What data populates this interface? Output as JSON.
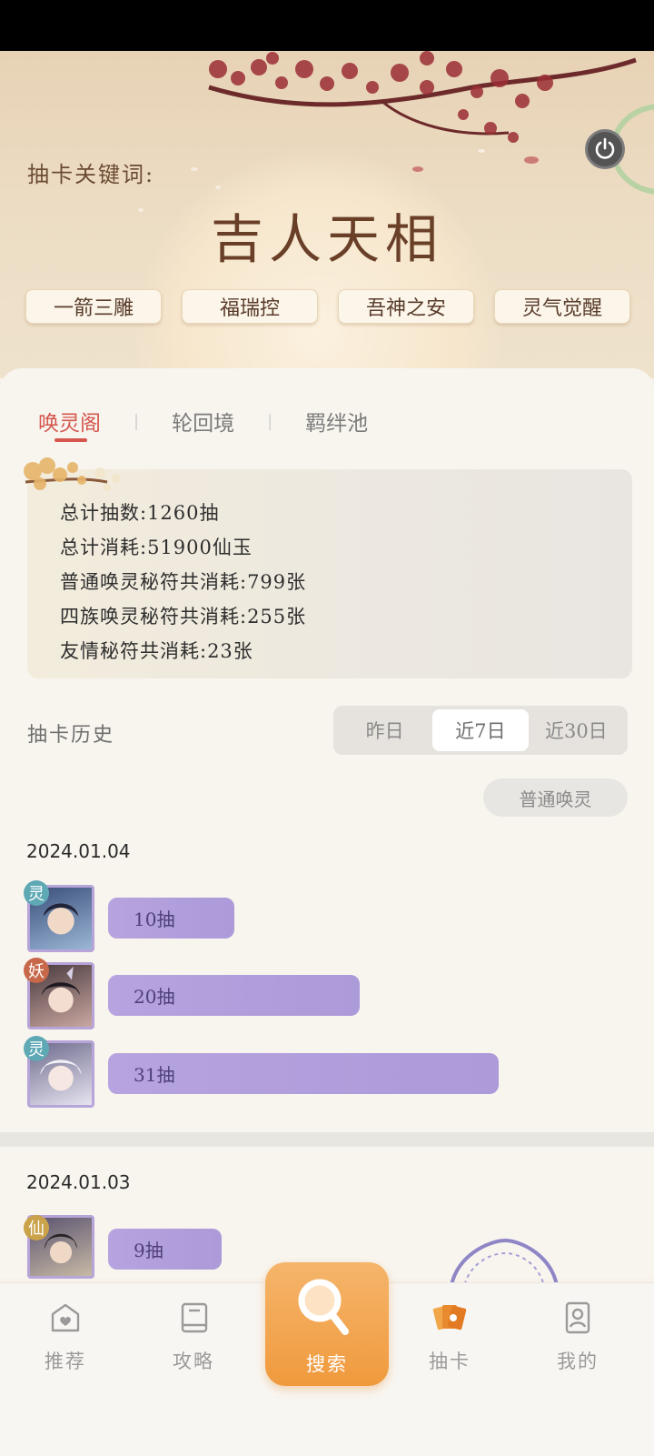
{
  "keyword": {
    "label": "抽卡关键词:",
    "title": "吉人天相",
    "chips": [
      "一箭三雕",
      "福瑞控",
      "吾神之安",
      "灵气觉醒"
    ]
  },
  "tabs": [
    "唤灵阁",
    "轮回境",
    "羁绊池"
  ],
  "stats": {
    "total_draws": "总计抽数:1260抽",
    "total_cost": "总计消耗:51900仙玉",
    "normal_talisman": "普通唤灵秘符共消耗:799张",
    "clan_talisman": "四族唤灵秘符共消耗:255张",
    "friend_talisman": "友情秘符共消耗:23张"
  },
  "history": {
    "label": "抽卡历史",
    "segments": [
      "昨日",
      "近7日",
      "近30日"
    ],
    "active_segment": "近7日",
    "filter": "普通唤灵",
    "days": [
      {
        "date": "2024.01.04",
        "entries": [
          {
            "badge": "灵",
            "badge_color": "#5fa9b5",
            "count": "10抽",
            "draws": 10
          },
          {
            "badge": "妖",
            "badge_color": "#c8684a",
            "count": "20抽",
            "draws": 20
          },
          {
            "badge": "灵",
            "badge_color": "#5fa9b5",
            "count": "31抽",
            "draws": 31
          }
        ]
      },
      {
        "date": "2024.01.03",
        "entries": [
          {
            "badge": "仙",
            "badge_color": "#c9a24a",
            "count": "9抽",
            "draws": 9
          }
        ]
      }
    ]
  },
  "nav": {
    "recommend": "推荐",
    "guide": "攻略",
    "search": "搜索",
    "draw": "抽卡",
    "mine": "我的"
  },
  "colors": {
    "accent": "#d4564c",
    "bar": "#b6a3df",
    "search": "#f09a3d",
    "active_nav": "#e2952e"
  }
}
